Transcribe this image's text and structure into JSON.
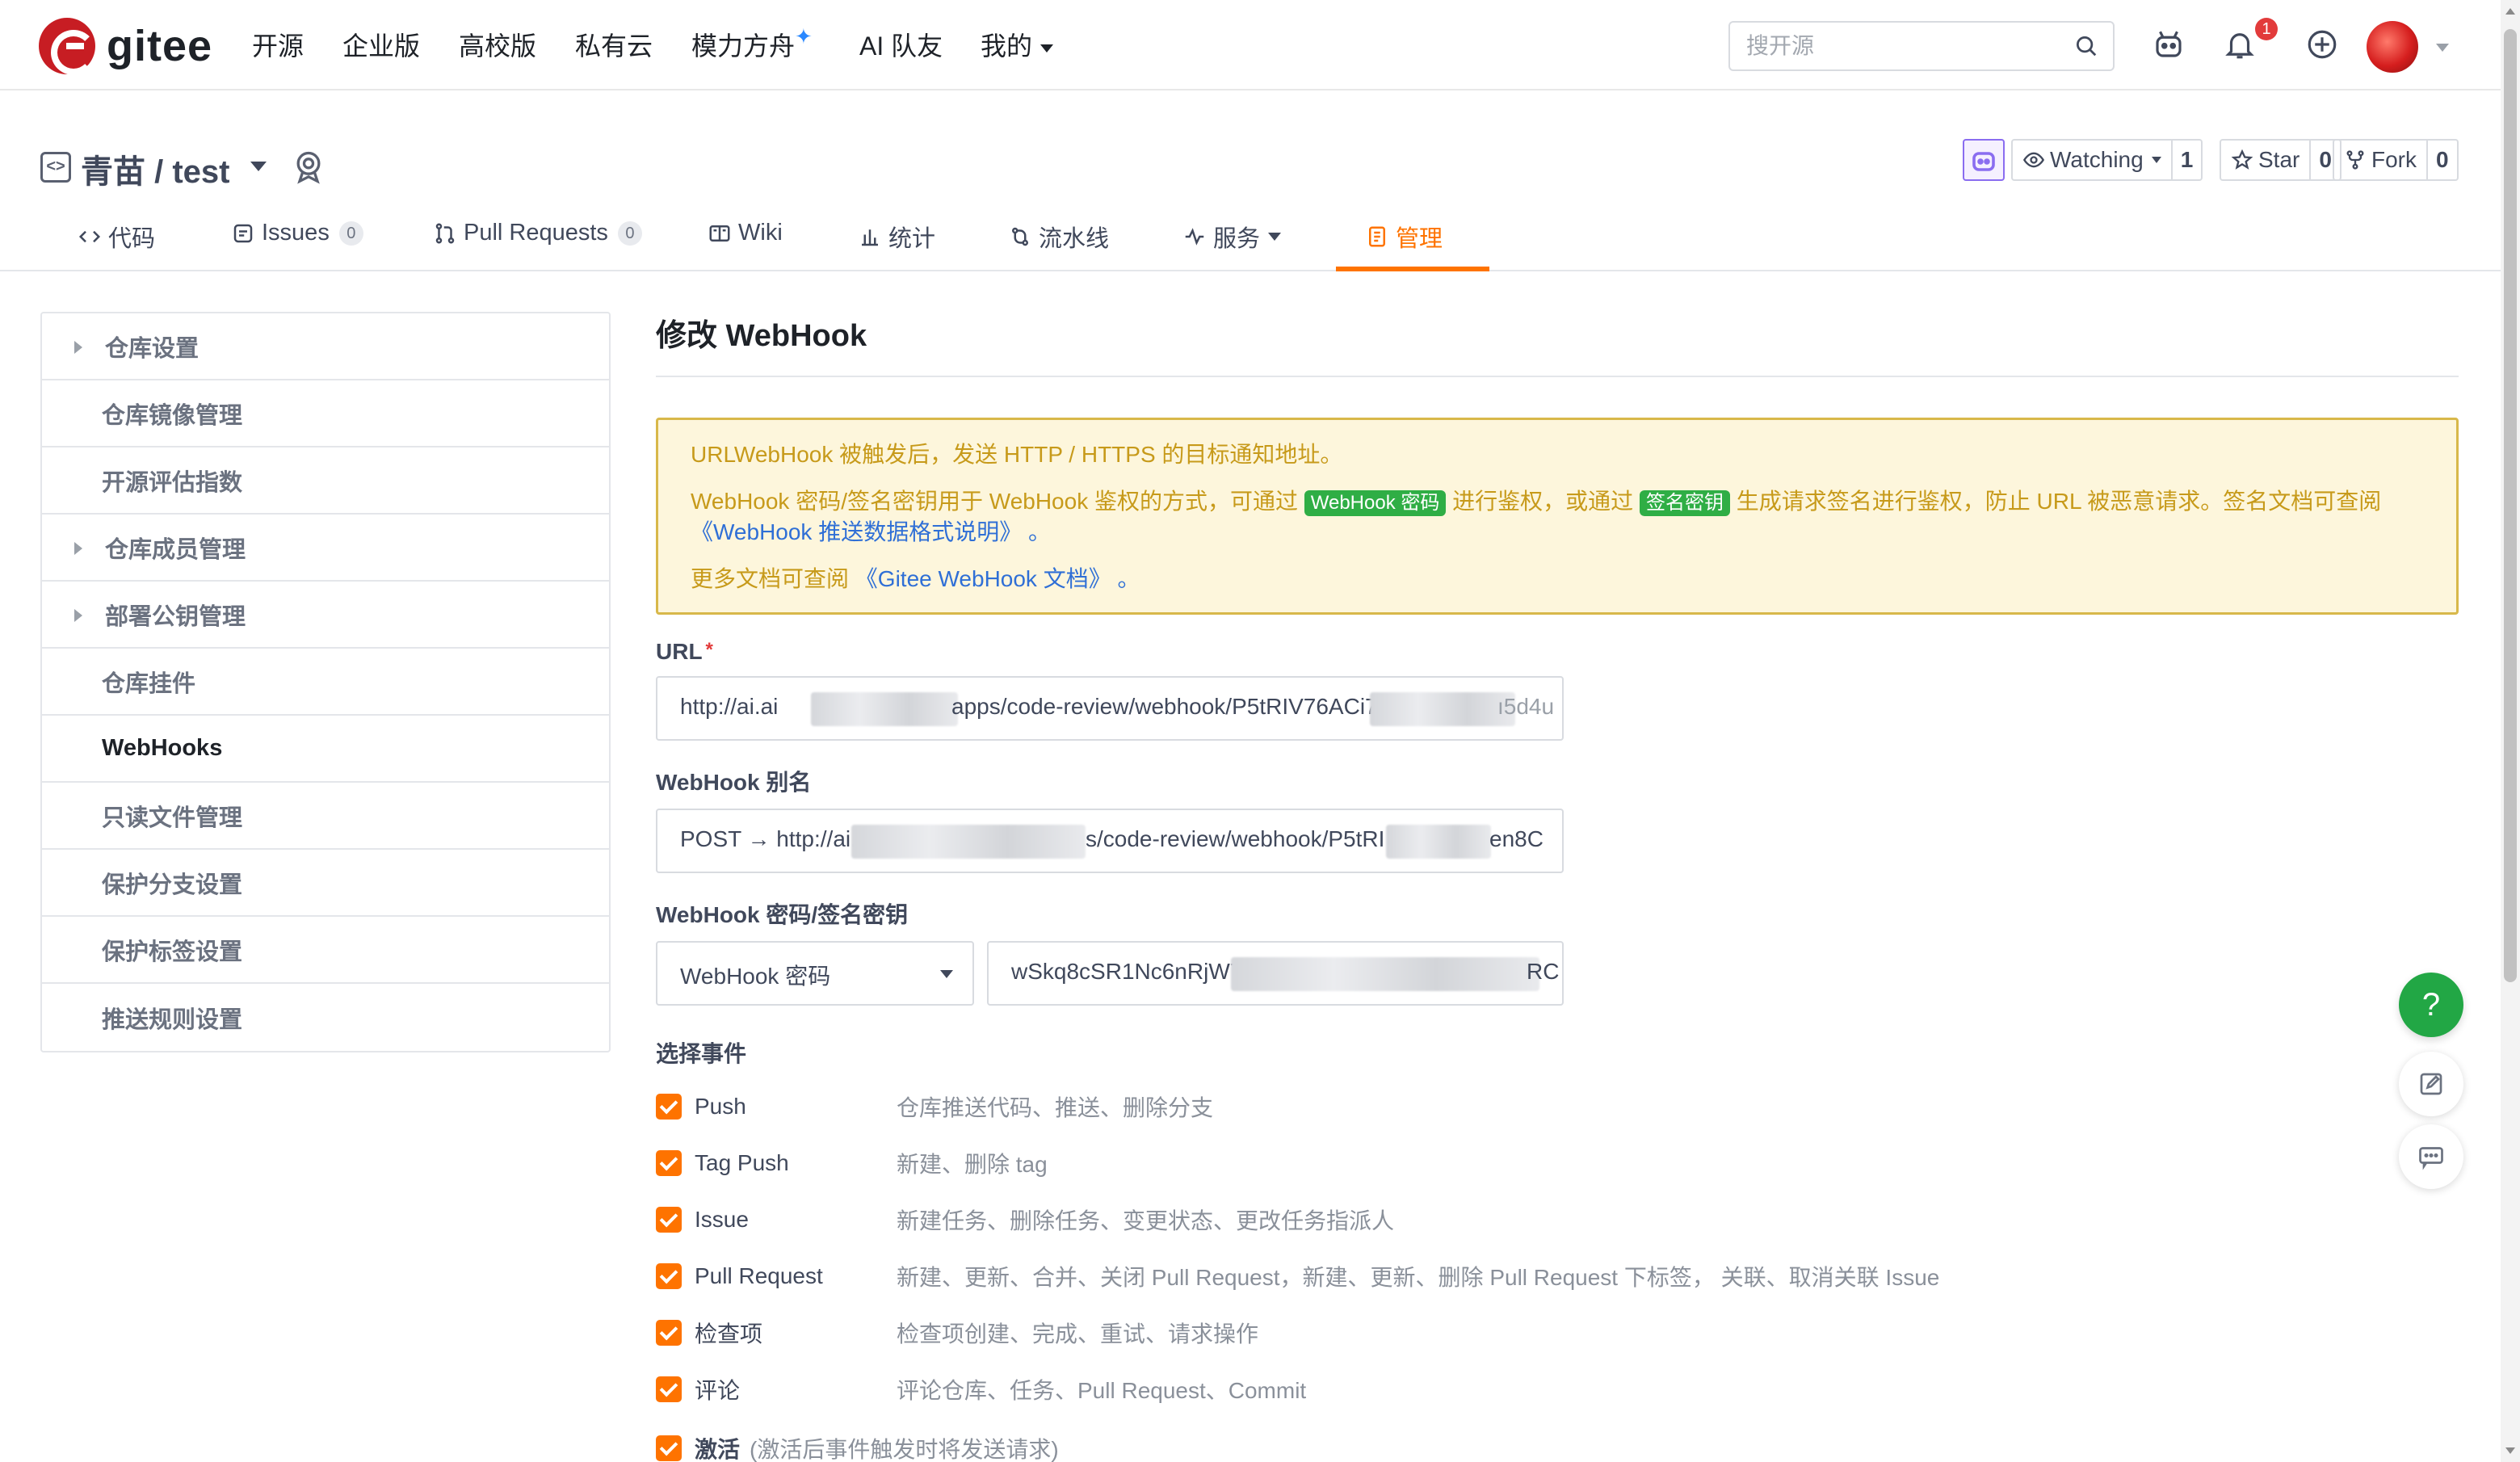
{
  "header": {
    "logo_text": "gitee",
    "nav": [
      "开源",
      "企业版",
      "高校版",
      "私有云",
      "模力方舟",
      "AI 队友",
      "我的"
    ],
    "search_placeholder": "搜开源",
    "notification_count": "1"
  },
  "repo": {
    "title": "青苗 / test",
    "watch_label": "Watching",
    "watch_count": "1",
    "star_label": "Star",
    "star_count": "0",
    "fork_label": "Fork",
    "fork_count": "0"
  },
  "tabs": [
    {
      "label": "代码"
    },
    {
      "label": "Issues",
      "count": "0"
    },
    {
      "label": "Pull Requests",
      "count": "0"
    },
    {
      "label": "Wiki"
    },
    {
      "label": "统计"
    },
    {
      "label": "流水线"
    },
    {
      "label": "服务"
    },
    {
      "label": "管理"
    }
  ],
  "sidebar": {
    "items": [
      "仓库设置",
      "仓库镜像管理",
      "开源评估指数",
      "仓库成员管理",
      "部署公钥管理",
      "仓库挂件",
      "WebHooks",
      "只读文件管理",
      "保护分支设置",
      "保护标签设置",
      "推送规则设置"
    ],
    "active": "WebHooks"
  },
  "main": {
    "title": "修改 WebHook",
    "notice": {
      "line1": "URLWebHook 被触发后，发送 HTTP / HTTPS 的目标通知地址。",
      "line2_a": "WebHook 密码/签名密钥用于 WebHook 鉴权的方式，可通过",
      "tag1": "WebHook 密码",
      "line2_b": "进行鉴权，或通过",
      "tag2": "签名密钥",
      "line2_c": "生成请求签名进行鉴权，防止 URL 被恶意请求。签名文档可查阅",
      "link1": "《WebHook 推送数据格式说明》",
      "link1_suffix": "。",
      "line3_a": "更多文档可查阅",
      "link2": "《Gitee WebHook 文档》",
      "link2_suffix": "。"
    },
    "url_label": "URL",
    "url_value_a": "http://ai.ai",
    "url_value_b": "apps/code-review/webhook/P5tRIV76ACi7",
    "url_value_c": "ı5d4u",
    "alias_label": "WebHook 别名",
    "alias_value_a": "POST → http://ai.",
    "alias_value_b": "s/code-review/webhook/P5tRI",
    "alias_value_c": "en8C",
    "secret_label": "WebHook 密码/签名密钥",
    "secret_type": "WebHook 密码",
    "secret_value_a": "wSkq8cSR1Nc6nRjW7",
    "secret_value_b": "RC",
    "events_title": "选择事件",
    "events": [
      {
        "name": "Push",
        "desc": "仓库推送代码、推送、删除分支"
      },
      {
        "name": "Tag Push",
        "desc": "新建、删除 tag"
      },
      {
        "name": "Issue",
        "desc": "新建任务、删除任务、变更状态、更改任务指派人"
      },
      {
        "name": "Pull Request",
        "desc": "新建、更新、合并、关闭 Pull Request，新建、更新、删除 Pull Request 下标签， 关联、取消关联 Issue"
      },
      {
        "name": "检查项",
        "desc": "检查项创建、完成、重试、请求操作"
      },
      {
        "name": "评论",
        "desc": "评论仓库、任务、Pull Request、Commit"
      }
    ],
    "activate_label": "激活",
    "activate_hint": "(激活后事件触发时将发送请求)"
  },
  "floating": {
    "help": "?"
  }
}
